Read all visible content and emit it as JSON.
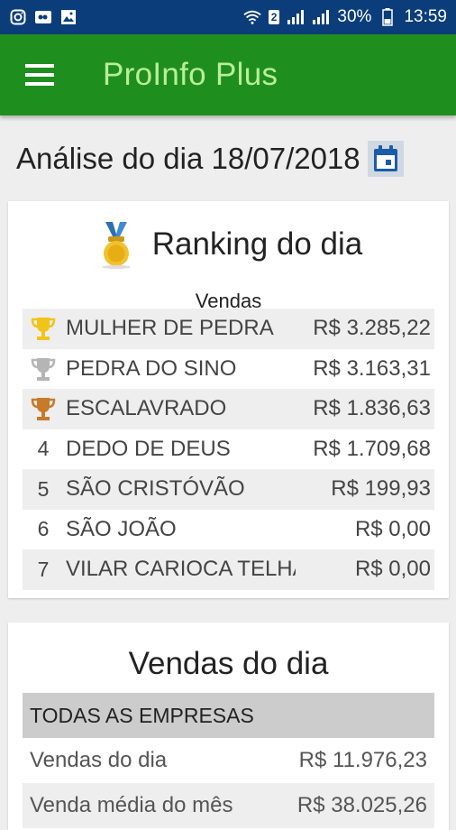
{
  "status_bar": {
    "left_icons": [
      "instagram-icon",
      "cloud-icon",
      "image-icon"
    ],
    "sim_badge": "2",
    "battery": "30%",
    "time": "13:59"
  },
  "app_bar": {
    "title": "ProInfo Plus",
    "menu_icon": "hamburger-menu-icon"
  },
  "date_header": {
    "text": "Análise do dia 18/07/2018",
    "calendar_icon": "calendar-icon"
  },
  "ranking": {
    "title": "Ranking do dia",
    "column_title": "Vendas",
    "colors": {
      "gold": "#f0c419",
      "silver": "#b5b5b5",
      "bronze": "#c67a2a"
    },
    "rows": [
      {
        "pos": "1",
        "trophy": "gold",
        "name": "MULHER DE PEDRA",
        "value": "R$ 3.285,22"
      },
      {
        "pos": "2",
        "trophy": "silver",
        "name": "PEDRA DO SINO",
        "value": "R$ 3.163,31"
      },
      {
        "pos": "3",
        "trophy": "bronze",
        "name": "ESCALAVRADO",
        "value": "R$ 1.836,63"
      },
      {
        "pos": "4",
        "trophy": "",
        "name": "DEDO DE DEUS",
        "value": "R$ 1.709,68"
      },
      {
        "pos": "5",
        "trophy": "",
        "name": "SÃO CRISTÓVÃO",
        "value": "R$ 199,93"
      },
      {
        "pos": "6",
        "trophy": "",
        "name": "SÃO JOÃO",
        "value": "R$ 0,00"
      },
      {
        "pos": "7",
        "trophy": "",
        "name": "VILAR CARIOCA TELHA",
        "value": "R$ 0,00"
      }
    ]
  },
  "sales": {
    "title": "Vendas do dia",
    "filter_label": "TODAS AS EMPRESAS",
    "rows": [
      {
        "label": "Vendas do dia",
        "value": "R$ 11.976,23"
      },
      {
        "label": "Venda média do mês",
        "value": "R$ 38.025,26"
      }
    ]
  }
}
